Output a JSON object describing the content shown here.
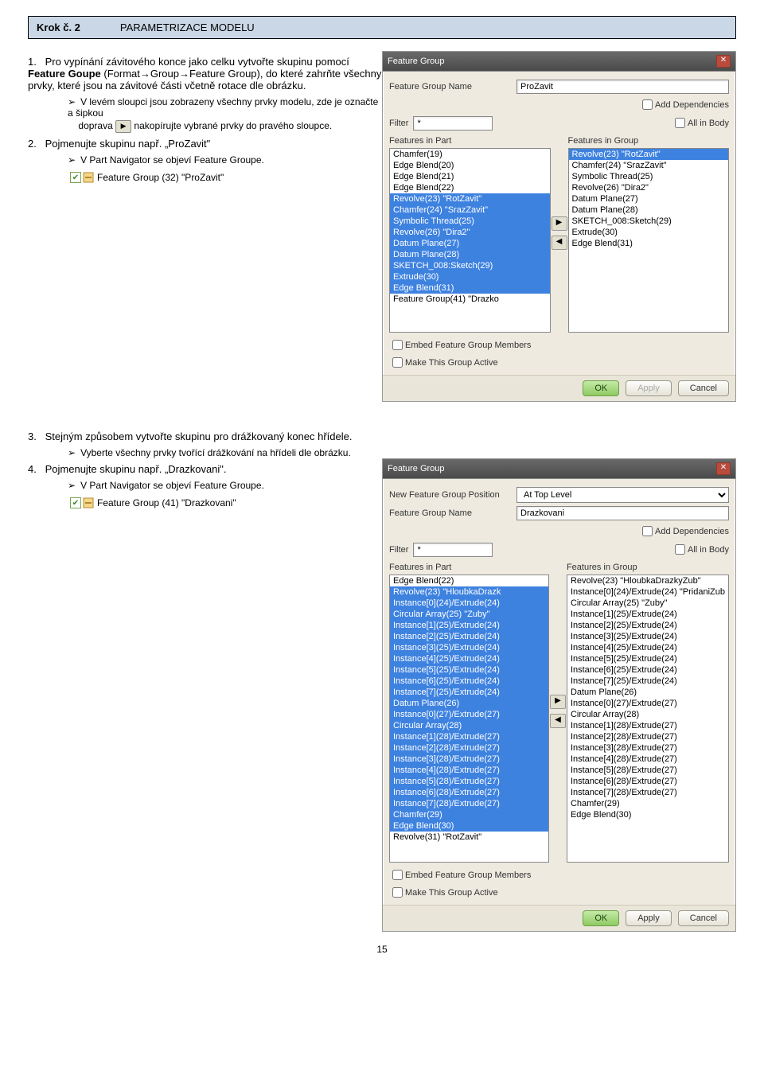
{
  "step": {
    "label": "Krok č. 2",
    "title": "PARAMETRIZACE MODELU"
  },
  "p1": {
    "num": "1.",
    "t1": "Pro vypínání závitového konce jako celku vytvořte skupinu pomocí ",
    "b1": "Feature Goupe",
    "t2": " (Format→Group→Feature Group), do které zahrňte všechny prvky, které jsou na závitové části včetně rotace dle obrázku.",
    "sub1": "V levém sloupci jsou zobrazeny všechny prvky modelu, zde je označte a šipkou",
    "sub2a": "doprava ",
    "sub2b": " nakopírujte vybrané prvky do pravého sloupce."
  },
  "p2": {
    "num": "2.",
    "t1": "Pojmenujte skupinu např. „ProZavit\"",
    "sub1": "V Part Navigator se objeví Feature Groupe."
  },
  "nav1": "Feature Group (32) \"ProZavit\"",
  "dlg1": {
    "title": "Feature Group",
    "nameLabel": "Feature Group Name",
    "nameValue": "ProZavit",
    "addDep": "Add Dependencies",
    "filterLabel": "Filter",
    "filterValue": "*",
    "allInBody": "All in Body",
    "leftLabel": "Features in Part",
    "rightLabel": "Features in Group",
    "leftItems": [
      {
        "t": "Chamfer(19)",
        "s": false
      },
      {
        "t": "Edge Blend(20)",
        "s": false
      },
      {
        "t": "Edge Blend(21)",
        "s": false
      },
      {
        "t": "Edge Blend(22)",
        "s": false
      },
      {
        "t": "Revolve(23)  \"RotZavit\"",
        "s": true
      },
      {
        "t": "Chamfer(24)  \"SrazZavit\"",
        "s": true
      },
      {
        "t": "Symbolic Thread(25)",
        "s": true
      },
      {
        "t": "Revolve(26)  \"Dira2\"",
        "s": true
      },
      {
        "t": "Datum Plane(27)",
        "s": true
      },
      {
        "t": "Datum Plane(28)",
        "s": true
      },
      {
        "t": "SKETCH_008:Sketch(29)",
        "s": true
      },
      {
        "t": "Extrude(30)",
        "s": true
      },
      {
        "t": "Edge Blend(31)",
        "s": true
      },
      {
        "t": "Feature Group(41)  \"Drazko",
        "s": false
      }
    ],
    "rightItems": [
      {
        "t": "Revolve(23)  \"RotZavit\"",
        "s": true
      },
      {
        "t": "Chamfer(24)  \"SrazZavit\"",
        "s": false
      },
      {
        "t": "Symbolic Thread(25)",
        "s": false
      },
      {
        "t": "Revolve(26)  \"Dira2\"",
        "s": false
      },
      {
        "t": "Datum Plane(27)",
        "s": false
      },
      {
        "t": "Datum Plane(28)",
        "s": false
      },
      {
        "t": "SKETCH_008:Sketch(29)",
        "s": false
      },
      {
        "t": "Extrude(30)",
        "s": false
      },
      {
        "t": "Edge Blend(31)",
        "s": false
      }
    ],
    "embed": "Embed Feature Group Members",
    "active": "Make This Group Active",
    "ok": "OK",
    "apply": "Apply",
    "cancel": "Cancel"
  },
  "p3": {
    "num": "3.",
    "t1": "Stejným způsobem vytvořte skupinu pro drážkovaný konec hřídele.",
    "sub1": "Vyberte všechny prvky tvořící drážkování na hřídeli dle obrázku."
  },
  "p4": {
    "num": "4.",
    "t1": "Pojmenujte skupinu např. „Drazkovani\".",
    "sub1": "V Part Navigator se objeví Feature Groupe."
  },
  "nav2": "Feature Group (41) \"Drazkovani\"",
  "dlg2": {
    "title": "Feature Group",
    "posLabel": "New Feature Group Position",
    "posValue": "At Top Level",
    "nameLabel": "Feature Group Name",
    "nameValue": "Drazkovani",
    "addDep": "Add Dependencies",
    "filterLabel": "Filter",
    "filterValue": "*",
    "allInBody": "All in Body",
    "leftLabel": "Features in Part",
    "rightLabel": "Features in Group",
    "leftItems": [
      {
        "t": "Edge Blend(22)",
        "s": false
      },
      {
        "t": "Revolve(23)  \"HloubkaDrazk",
        "s": true
      },
      {
        "t": "Instance[0](24)/Extrude(24)",
        "s": true
      },
      {
        "t": "Circular Array(25)  \"Zuby\"",
        "s": true
      },
      {
        "t": "Instance[1](25)/Extrude(24)",
        "s": true
      },
      {
        "t": "Instance[2](25)/Extrude(24)",
        "s": true
      },
      {
        "t": "Instance[3](25)/Extrude(24)",
        "s": true
      },
      {
        "t": "Instance[4](25)/Extrude(24)",
        "s": true
      },
      {
        "t": "Instance[5](25)/Extrude(24)",
        "s": true
      },
      {
        "t": "Instance[6](25)/Extrude(24)",
        "s": true
      },
      {
        "t": "Instance[7](25)/Extrude(24)",
        "s": true
      },
      {
        "t": "Datum Plane(26)",
        "s": true
      },
      {
        "t": "Instance[0](27)/Extrude(27)",
        "s": true
      },
      {
        "t": "Circular Array(28)",
        "s": true
      },
      {
        "t": "Instance[1](28)/Extrude(27)",
        "s": true
      },
      {
        "t": "Instance[2](28)/Extrude(27)",
        "s": true
      },
      {
        "t": "Instance[3](28)/Extrude(27)",
        "s": true
      },
      {
        "t": "Instance[4](28)/Extrude(27)",
        "s": true
      },
      {
        "t": "Instance[5](28)/Extrude(27)",
        "s": true
      },
      {
        "t": "Instance[6](28)/Extrude(27)",
        "s": true
      },
      {
        "t": "Instance[7](28)/Extrude(27)",
        "s": true
      },
      {
        "t": "Chamfer(29)",
        "s": true
      },
      {
        "t": "Edge Blend(30)",
        "s": true
      },
      {
        "t": "Revolve(31)  \"RotZavit\"",
        "s": false
      }
    ],
    "rightItems": [
      {
        "t": "Revolve(23)  \"HloubkaDrazkyZub\"",
        "s": false
      },
      {
        "t": "Instance[0](24)/Extrude(24)  \"PridaniZub",
        "s": false
      },
      {
        "t": "Circular Array(25)  \"Zuby\"",
        "s": false
      },
      {
        "t": "Instance[1](25)/Extrude(24)",
        "s": false
      },
      {
        "t": "Instance[2](25)/Extrude(24)",
        "s": false
      },
      {
        "t": "Instance[3](25)/Extrude(24)",
        "s": false
      },
      {
        "t": "Instance[4](25)/Extrude(24)",
        "s": false
      },
      {
        "t": "Instance[5](25)/Extrude(24)",
        "s": false
      },
      {
        "t": "Instance[6](25)/Extrude(24)",
        "s": false
      },
      {
        "t": "Instance[7](25)/Extrude(24)",
        "s": false
      },
      {
        "t": "Datum Plane(26)",
        "s": false
      },
      {
        "t": "Instance[0](27)/Extrude(27)",
        "s": false
      },
      {
        "t": "Circular Array(28)",
        "s": false
      },
      {
        "t": "Instance[1](28)/Extrude(27)",
        "s": false
      },
      {
        "t": "Instance[2](28)/Extrude(27)",
        "s": false
      },
      {
        "t": "Instance[3](28)/Extrude(27)",
        "s": false
      },
      {
        "t": "Instance[4](28)/Extrude(27)",
        "s": false
      },
      {
        "t": "Instance[5](28)/Extrude(27)",
        "s": false
      },
      {
        "t": "Instance[6](28)/Extrude(27)",
        "s": false
      },
      {
        "t": "Instance[7](28)/Extrude(27)",
        "s": false
      },
      {
        "t": "Chamfer(29)",
        "s": false
      },
      {
        "t": "Edge Blend(30)",
        "s": false
      }
    ],
    "embed": "Embed Feature Group Members",
    "active": "Make This Group Active",
    "ok": "OK",
    "apply": "Apply",
    "cancel": "Cancel"
  },
  "pageNum": "15"
}
